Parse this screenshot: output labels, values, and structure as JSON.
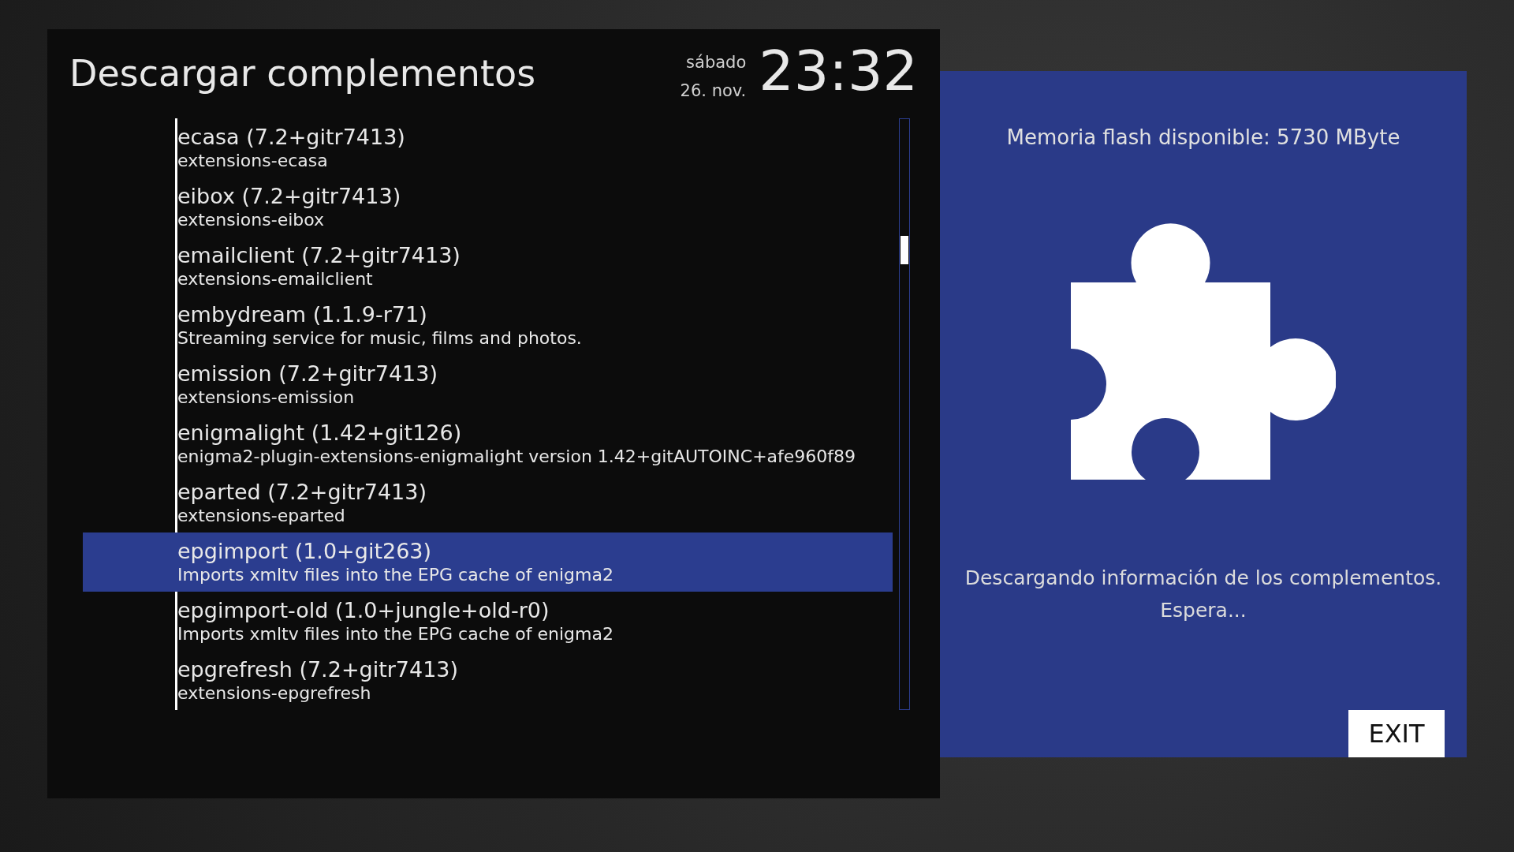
{
  "header": {
    "title": "Descargar complementos",
    "weekday": "sábado",
    "date": "26. nov.",
    "time": "23:32"
  },
  "plugins": [
    {
      "name": "ecasa",
      "version": "(7.2+gitr7413)",
      "description": "extensions-ecasa",
      "selected": false
    },
    {
      "name": "eibox",
      "version": "(7.2+gitr7413)",
      "description": "extensions-eibox",
      "selected": false
    },
    {
      "name": "emailclient",
      "version": "(7.2+gitr7413)",
      "description": "extensions-emailclient",
      "selected": false
    },
    {
      "name": "embydream",
      "version": "(1.1.9-r71)",
      "description": "Streaming service for music, films and photos.",
      "selected": false
    },
    {
      "name": "emission",
      "version": "(7.2+gitr7413)",
      "description": "extensions-emission",
      "selected": false
    },
    {
      "name": "enigmalight",
      "version": "(1.42+git126)",
      "description": "enigma2-plugin-extensions-enigmalight version 1.42+gitAUTOINC+afe960f89",
      "selected": false
    },
    {
      "name": "eparted",
      "version": "(7.2+gitr7413)",
      "description": "extensions-eparted",
      "selected": false
    },
    {
      "name": "epgimport",
      "version": "(1.0+git263)",
      "description": "Imports xmltv files into the EPG cache of enigma2",
      "selected": true
    },
    {
      "name": "epgimport-old",
      "version": "(1.0+jungle+old-r0)",
      "description": "Imports xmltv files into the EPG cache of enigma2",
      "selected": false
    },
    {
      "name": "epgrefresh",
      "version": "(7.2+gitr7413)",
      "description": "extensions-epgrefresh",
      "selected": false
    }
  ],
  "info_panel": {
    "memory": "Memoria flash disponible: 5730 MByte",
    "status_lines": [
      "Descargando información de los complementos.",
      "Espera..."
    ],
    "exit_button": "EXIT"
  }
}
